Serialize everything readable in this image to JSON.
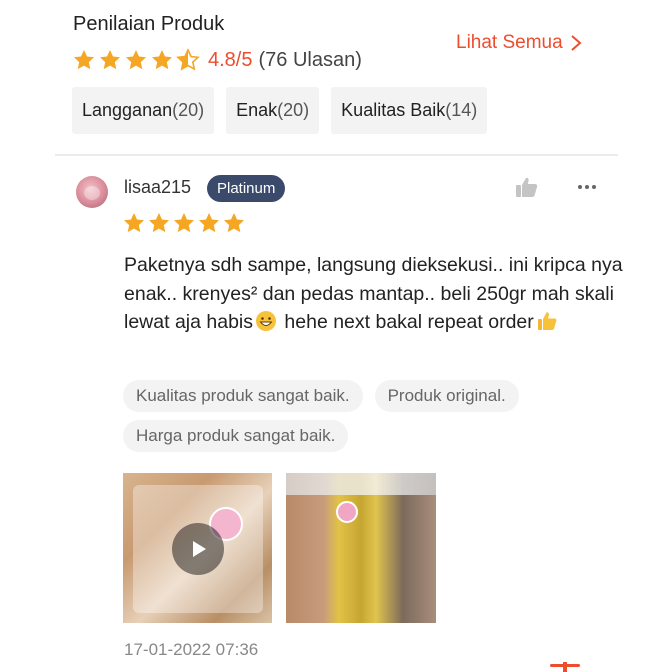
{
  "header": {
    "title": "Penilaian Produk",
    "see_all": "Lihat Semua"
  },
  "rating": {
    "score": "4.8/5",
    "count": "(76 Ulasan)",
    "stars_value": 4.5,
    "star_color": "#f5a623"
  },
  "filters": [
    {
      "label": "Langganan",
      "count": "(20)"
    },
    {
      "label": "Enak",
      "count": "(20)"
    },
    {
      "label": "Kualitas Baik",
      "count": "(14)"
    }
  ],
  "review": {
    "username": "lisaa215",
    "badge": "Platinum",
    "stars": 5,
    "text_part1": "Paketnya sdh sampe, langsung dieksekusi.. ini kripca nya enak.. krenyes² dan pedas mantap.. beli 250gr mah skali lewat aja habis",
    "text_part2": " hehe next bakal repeat order",
    "tags": [
      "Kualitas produk sangat baik.",
      "Produk original.",
      "Harga produk sangat baik."
    ],
    "date": "17-01-2022 07:36",
    "media": [
      {
        "type": "video"
      },
      {
        "type": "image"
      }
    ]
  },
  "icons": {
    "chevron": "chevron-right-icon",
    "like": "thumbs-up-icon",
    "more": "more-options-icon",
    "play": "play-icon"
  },
  "colors": {
    "accent": "#ee4d2d",
    "badge_bg": "#3b4a6b",
    "chip_bg": "#f3f3f3"
  }
}
